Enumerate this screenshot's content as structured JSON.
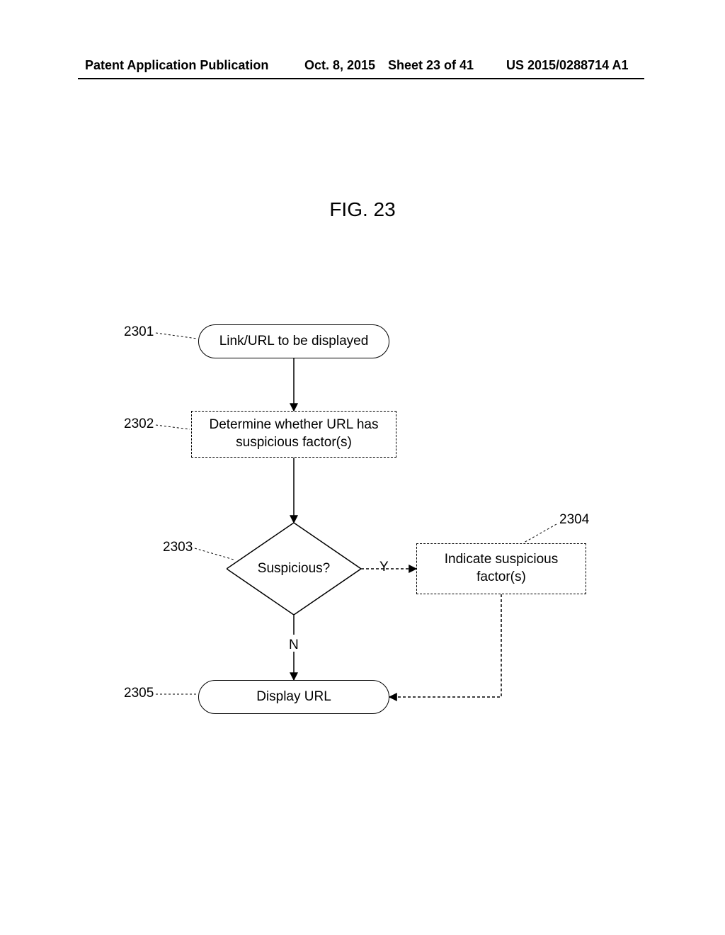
{
  "header": {
    "left": "Patent Application Publication",
    "date": "Oct. 8, 2015",
    "sheet": "Sheet 23 of 41",
    "pubno": "US 2015/0288714 A1"
  },
  "figure_title": "FIG. 23",
  "refs": {
    "r2301": "2301",
    "r2302": "2302",
    "r2303": "2303",
    "r2304": "2304",
    "r2305": "2305"
  },
  "nodes": {
    "start": "Link/URL to be displayed",
    "determine": "Determine whether URL has suspicious factor(s)",
    "decision": "Suspicious?",
    "indicate": "Indicate suspicious factor(s)",
    "display": "Display URL"
  },
  "edges": {
    "yes": "Y",
    "no": "N"
  }
}
